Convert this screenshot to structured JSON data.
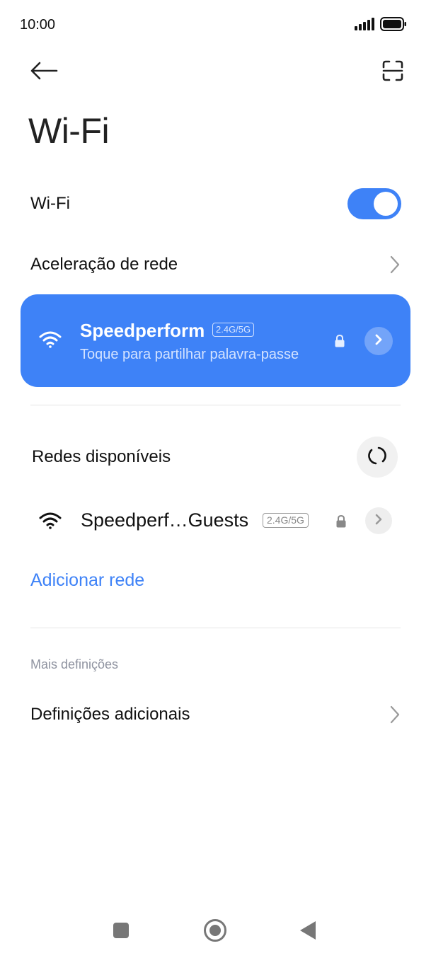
{
  "status_bar": {
    "time": "10:00",
    "icons": [
      "signal-icon",
      "battery-icon"
    ]
  },
  "header": {
    "title": "Wi-Fi",
    "back_icon": "back-arrow-icon",
    "scan_icon": "qr-scan-icon"
  },
  "wifi_toggle": {
    "label": "Wi-Fi",
    "enabled": true
  },
  "network_acceleration": {
    "label": "Aceleração de rede"
  },
  "connected_network": {
    "name": "Speedperform",
    "band": "2.4G/5G",
    "subtitle": "Toque para partilhar palavra-passe",
    "secured": true
  },
  "available_networks": {
    "heading": "Redes disponíveis",
    "items": [
      {
        "name": "Speedperf…Guests",
        "band": "2.4G/5G",
        "secured": true
      }
    ]
  },
  "add_network": {
    "label": "Adicionar rede"
  },
  "more_settings": {
    "section_label": "Mais definições",
    "additional_label": "Definições adicionais"
  },
  "colors": {
    "accent": "#3e82f7",
    "text": "#111111",
    "muted": "#8f93a0"
  }
}
